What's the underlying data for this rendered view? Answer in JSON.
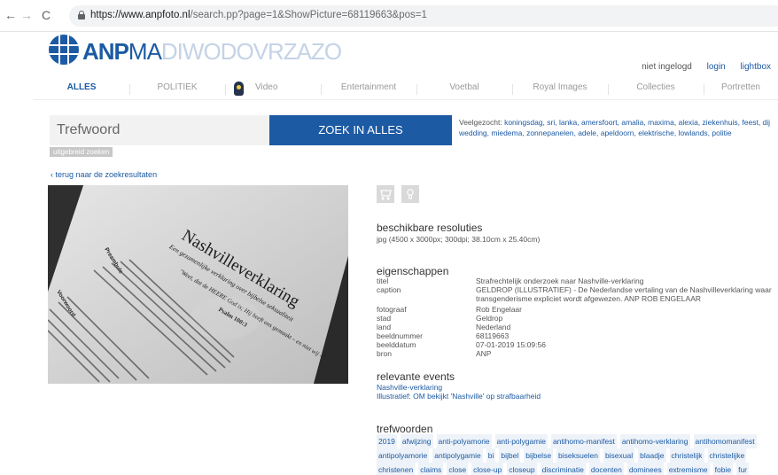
{
  "browser": {
    "url_host": "https://www.anpfoto.nl",
    "url_path": "/search.pp?page=1&ShowPicture=68119663&pos=1"
  },
  "brand": {
    "anp": "ANP",
    "ma": "MA",
    "rest": "DIWODOVRZAZO"
  },
  "login": {
    "status": "niet ingelogd",
    "login": "login",
    "lightbox": "lightbox"
  },
  "nav": [
    "ALLES",
    "POLITIEK",
    "Video",
    "Entertainment",
    "Voetbal",
    "Royal Images",
    "Collecties",
    "Portretten"
  ],
  "search": {
    "placeholder": "Trefwoord",
    "button": "ZOEK IN ALLES",
    "advanced": "uitgebreid zoeken"
  },
  "popular": {
    "label": "Veelgezocht:",
    "terms": "koningsdag, sri, lanka, amersfoort, amalia, maxima, alexia, ziekenhuis, feest, dij wedding, miedema, zonnepanelen, adele, apeldoorn, elektrische, lowlands, politie"
  },
  "back_link": "‹ terug naar de zoekresultaten",
  "photo_text": {
    "title": "Nashvilleverklaring",
    "subtitle": "Een gezamenlijke verklaring over bijbelse seksualiteit",
    "quote": "\"Weet, dat de HEERE God is; Hij heeft ons gemaakt – en niet wij –\"",
    "psalm": "Psalm 100:3",
    "preambule": "Preambule",
    "voorwoord": "Voorwoord"
  },
  "resolutions": {
    "title": "beschikbare resoluties",
    "text": "jpg (4500 x 3000px; 300dpi; 38.10cm x 25.40cm)"
  },
  "properties": {
    "title": "eigenschappen",
    "rows": [
      {
        "label": "titel",
        "value": "Strafrechtelijk onderzoek naar Nashville-verklaring"
      },
      {
        "label": "caption",
        "value": "GELDROP (ILLUSTRATIEF) - De Nederlandse vertaling van de Nashvilleverklaring waar"
      },
      {
        "label": "",
        "value": "transgenderisme expliciet wordt afgewezen. ANP ROB ENGELAAR"
      },
      {
        "label": "fotograaf",
        "value": "Rob Engelaar"
      },
      {
        "label": "stad",
        "value": "Geldrop"
      },
      {
        "label": "land",
        "value": "Nederland"
      },
      {
        "label": "beeldnummer",
        "value": "68119663"
      },
      {
        "label": "beelddatum",
        "value": "07-01-2019 15:09:56"
      },
      {
        "label": "bron",
        "value": "ANP"
      }
    ]
  },
  "events": {
    "title": "relevante events",
    "items": [
      "Nashville-verklaring",
      "Illustratief: OM bekijkt 'Nashville' op strafbaarheid"
    ]
  },
  "keywords": {
    "title": "trefwoorden",
    "items": [
      "2019",
      "afwijzing",
      "anti-polyamorie",
      "anti-polygamie",
      "antihomo-manifest",
      "antihomo-verklaring",
      "antihomomanifest",
      "antipolyamorie",
      "antipolygamie",
      "bi",
      "bijbel",
      "bijbelse",
      "biseksuelen",
      "bisexual",
      "blaadje",
      "christelijk",
      "christelijke",
      "christenen",
      "claims",
      "close",
      "close-up",
      "closeup",
      "discriminatie",
      "docenten",
      "dominees",
      "extremisme",
      "fobie",
      "fur"
    ]
  }
}
